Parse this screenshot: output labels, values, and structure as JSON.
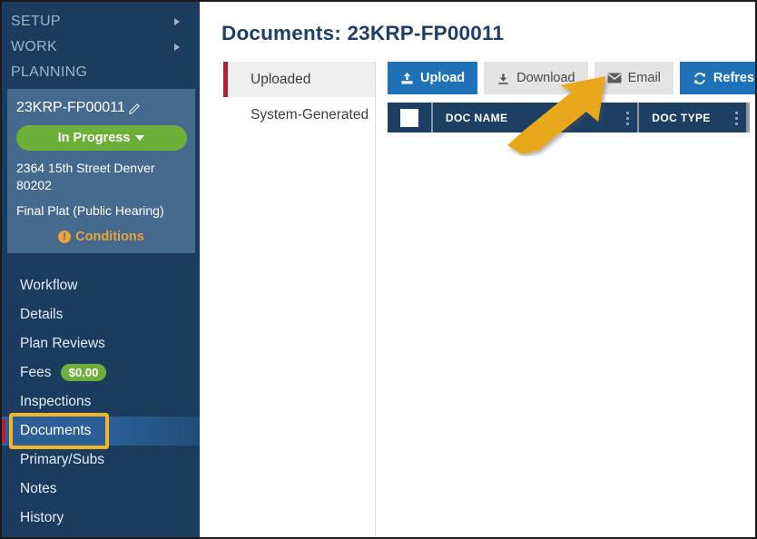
{
  "sidebar": {
    "top_menu": [
      {
        "label": "SETUP",
        "has_caret": true,
        "icon": "chevron-right-icon"
      },
      {
        "label": "WORK",
        "has_caret": true,
        "icon": "chevron-right-icon"
      },
      {
        "label": "PLANNING",
        "has_caret": false,
        "icon": ""
      }
    ],
    "project_card": {
      "project_id": "23KRP-FP00011",
      "edit_icon": "pencil-icon",
      "status_label": "In Progress",
      "status_color": "#6cb03a",
      "address_line1": "2364 15th Street Denver",
      "address_line2": "80202",
      "record_type": "Final Plat (Public Hearing)",
      "conditions_label": "Conditions",
      "conditions_icon": "warning-icon",
      "conditions_color": "#e8a33d"
    },
    "nav_items": [
      {
        "label": "Workflow",
        "active": false,
        "badge": ""
      },
      {
        "label": "Details",
        "active": false,
        "badge": ""
      },
      {
        "label": "Plan Reviews",
        "active": false,
        "badge": ""
      },
      {
        "label": "Fees",
        "active": false,
        "badge": "$0.00"
      },
      {
        "label": "Inspections",
        "active": false,
        "badge": ""
      },
      {
        "label": "Documents",
        "active": true,
        "badge": ""
      },
      {
        "label": "Primary/Subs",
        "active": false,
        "badge": ""
      },
      {
        "label": "Notes",
        "active": false,
        "badge": ""
      },
      {
        "label": "History",
        "active": false,
        "badge": ""
      }
    ]
  },
  "main": {
    "page_title": "Documents: 23KRP-FP00011",
    "tabs": [
      {
        "label": "Uploaded",
        "active": true
      },
      {
        "label": "System-Generated",
        "active": false
      }
    ],
    "toolbar": [
      {
        "label": "Upload",
        "icon": "upload-icon",
        "style": "primary"
      },
      {
        "label": "Download",
        "icon": "download-icon",
        "style": "secondary"
      },
      {
        "label": "Email",
        "icon": "envelope-icon",
        "style": "secondary"
      },
      {
        "label": "Refresh",
        "icon": "refresh-icon",
        "style": "primary"
      }
    ],
    "grid": {
      "select_all_checkbox": "unchecked",
      "columns": [
        {
          "label": "DOC NAME",
          "menu_icon": "kebab-menu-icon"
        },
        {
          "label": "DOC TYPE",
          "menu_icon": "kebab-menu-icon"
        }
      ],
      "rows": []
    }
  },
  "annotations": {
    "arrow": {
      "icon": "arrow-pointer",
      "color": "#e8a81e",
      "points_to": "Upload"
    },
    "highlight_box": {
      "target": "Documents",
      "color": "#f2b528"
    }
  }
}
